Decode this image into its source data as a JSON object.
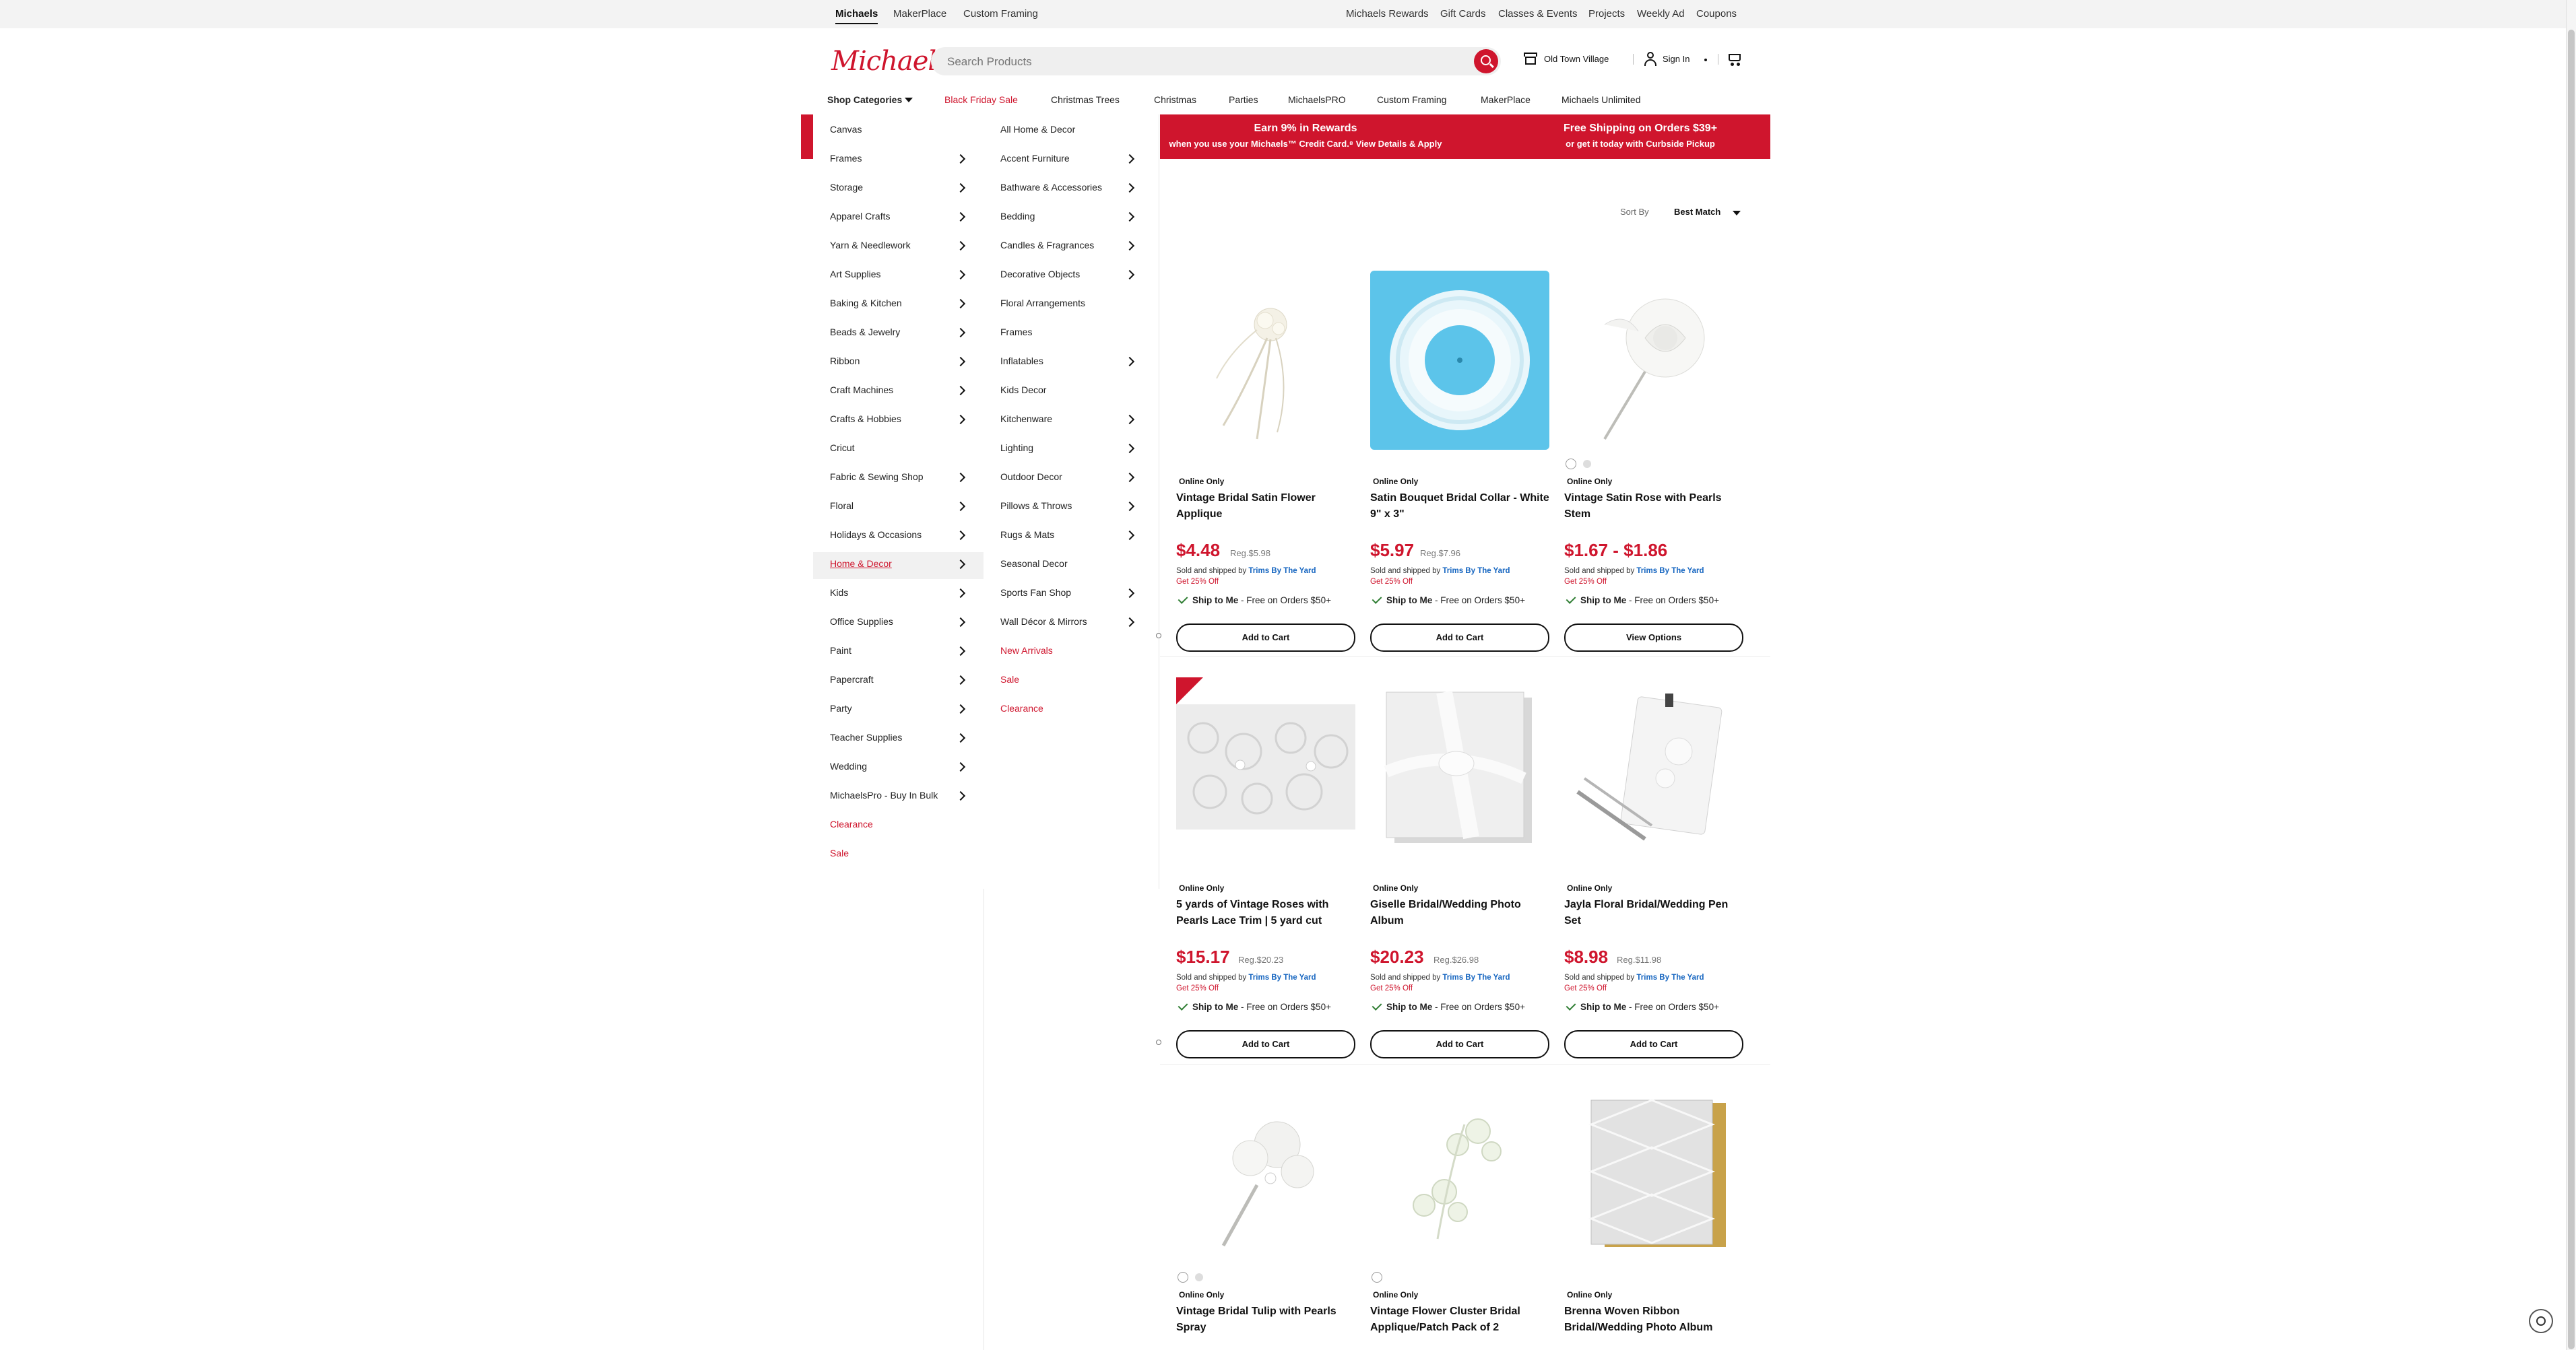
{
  "util_bar": {
    "left": [
      "Michaels",
      "MakerPlace",
      "Custom Framing"
    ],
    "right": [
      "Michaels Rewards",
      "Gift Cards",
      "Classes & Events",
      "Projects",
      "Weekly Ad",
      "Coupons"
    ]
  },
  "header": {
    "logo": "Michaels",
    "search_placeholder": "Search Products",
    "store": "Old Town Village",
    "signin": "Sign In"
  },
  "nav": {
    "shop_categories": "Shop Categories",
    "items": [
      "Black Friday Sale",
      "Christmas Trees",
      "Christmas",
      "Parties",
      "MichaelsPRO",
      "Custom Framing",
      "MakerPlace",
      "Michaels Unlimited"
    ]
  },
  "menu": {
    "col1": [
      {
        "label": "Canvas",
        "chevron": false
      },
      {
        "label": "Frames",
        "chevron": true
      },
      {
        "label": "Storage",
        "chevron": true
      },
      {
        "label": "Apparel Crafts",
        "chevron": true
      },
      {
        "label": "Yarn & Needlework",
        "chevron": true
      },
      {
        "label": "Art Supplies",
        "chevron": true
      },
      {
        "label": "Baking & Kitchen",
        "chevron": true
      },
      {
        "label": "Beads & Jewelry",
        "chevron": true
      },
      {
        "label": "Ribbon",
        "chevron": true
      },
      {
        "label": "Craft Machines",
        "chevron": true
      },
      {
        "label": "Crafts & Hobbies",
        "chevron": true
      },
      {
        "label": "Cricut",
        "chevron": false
      },
      {
        "label": "Fabric & Sewing Shop",
        "chevron": true
      },
      {
        "label": "Floral",
        "chevron": true
      },
      {
        "label": "Holidays & Occasions",
        "chevron": true
      },
      {
        "label": "Home & Decor",
        "chevron": true
      },
      {
        "label": "Kids",
        "chevron": true
      },
      {
        "label": "Office Supplies",
        "chevron": true
      },
      {
        "label": "Paint",
        "chevron": true
      },
      {
        "label": "Papercraft",
        "chevron": true
      },
      {
        "label": "Party",
        "chevron": true
      },
      {
        "label": "Teacher Supplies",
        "chevron": true
      },
      {
        "label": "Wedding",
        "chevron": true
      },
      {
        "label": "MichaelsPro - Buy In Bulk",
        "chevron": true
      },
      {
        "label": "Clearance",
        "chevron": false
      },
      {
        "label": "Sale",
        "chevron": false
      }
    ],
    "col2": [
      {
        "label": "All Home & Decor",
        "chevron": false
      },
      {
        "label": "Accent Furniture",
        "chevron": true
      },
      {
        "label": "Bathware & Accessories",
        "chevron": true
      },
      {
        "label": "Bedding",
        "chevron": true
      },
      {
        "label": "Candles & Fragrances",
        "chevron": true
      },
      {
        "label": "Decorative Objects",
        "chevron": true
      },
      {
        "label": "Floral Arrangements",
        "chevron": false
      },
      {
        "label": "Frames",
        "chevron": false
      },
      {
        "label": "Inflatables",
        "chevron": true
      },
      {
        "label": "Kids Decor",
        "chevron": false
      },
      {
        "label": "Kitchenware",
        "chevron": true
      },
      {
        "label": "Lighting",
        "chevron": true
      },
      {
        "label": "Outdoor Decor",
        "chevron": true
      },
      {
        "label": "Pillows & Throws",
        "chevron": true
      },
      {
        "label": "Rugs & Mats",
        "chevron": true
      },
      {
        "label": "Seasonal Decor",
        "chevron": false
      },
      {
        "label": "Sports Fan Shop",
        "chevron": true
      },
      {
        "label": "Wall Décor & Mirrors",
        "chevron": true
      },
      {
        "label": "New Arrivals",
        "chevron": false
      },
      {
        "label": "Sale",
        "chevron": false
      },
      {
        "label": "Clearance",
        "chevron": false
      }
    ]
  },
  "banner": {
    "left_title": "Earn 9% in Rewards",
    "left_sub": "when you use your Michaels™ Credit Card.⁸ View Details & Apply",
    "right_title": "Free Shipping on Orders $39+",
    "right_sub": "or get it today with Curbside Pickup"
  },
  "sort": {
    "label": "Sort By",
    "value": "Best Match"
  },
  "common": {
    "online_only": "Online Only",
    "sold_by_prefix": "Sold and shipped by",
    "seller": "Trims By The Yard",
    "off": "Get 25% Off",
    "ship_to_me": "Ship to Me",
    "ship_free": "- Free on Orders $50+",
    "add_to_cart": "Add to Cart",
    "view_options": "View Options"
  },
  "products": [
    {
      "name": "Vintage Bridal Satin Flower Applique",
      "price": "$4.48",
      "reg": "Reg.$5.98",
      "button": "Add to Cart"
    },
    {
      "name": "Satin Bouquet Bridal Collar - White 9\" x 3\"",
      "price": "$5.97",
      "reg": "Reg.$7.96",
      "button": "Add to Cart"
    },
    {
      "name": "Vintage Satin Rose with Pearls Stem",
      "price": "$1.67 - $1.86",
      "reg": "",
      "button": "View Options"
    },
    {
      "name": "5 yards of Vintage Roses with Pearls Lace Trim | 5 yard cut",
      "price": "$15.17",
      "reg": "Reg.$20.23",
      "button": "Add to Cart"
    },
    {
      "name": "Giselle Bridal/Wedding Photo Album",
      "price": "$20.23",
      "reg": "Reg.$26.98",
      "button": "Add to Cart"
    },
    {
      "name": "Jayla Floral Bridal/Wedding Pen Set",
      "price": "$8.98",
      "reg": "Reg.$11.98",
      "button": "Add to Cart"
    },
    {
      "name": "Vintage Bridal Tulip with Pearls Spray"
    },
    {
      "name": "Vintage Flower Cluster Bridal Applique/Patch Pack of 2"
    },
    {
      "name": "Brenna Woven Ribbon Bridal/Wedding Photo Album"
    }
  ]
}
